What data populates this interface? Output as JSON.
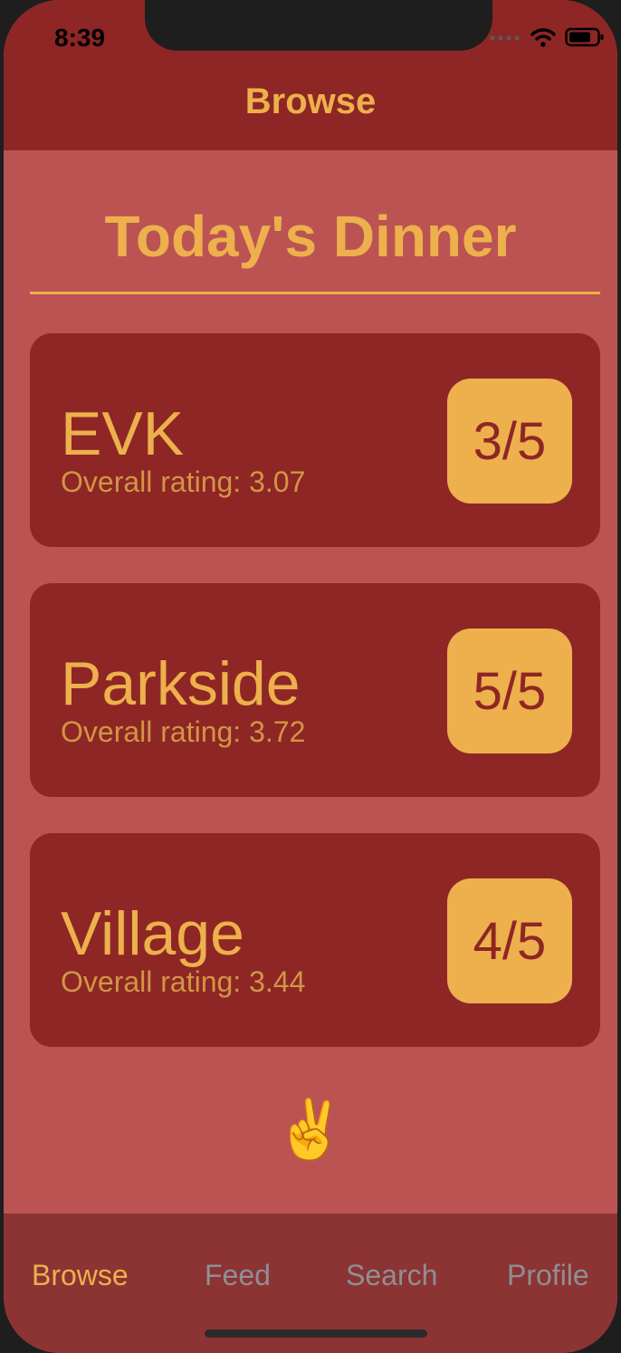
{
  "status_bar": {
    "time": "8:39"
  },
  "nav": {
    "title": "Browse"
  },
  "section": {
    "title": "Today's Dinner"
  },
  "cards": [
    {
      "name": "EVK",
      "rating_text": "Overall rating: 3.07",
      "score": "3/5"
    },
    {
      "name": "Parkside",
      "rating_text": "Overall rating: 3.72",
      "score": "5/5"
    },
    {
      "name": "Village",
      "rating_text": "Overall rating: 3.44",
      "score": "4/5"
    }
  ],
  "footer_emoji": "✌️",
  "tabs": [
    {
      "label": "Browse",
      "active": true
    },
    {
      "label": "Feed",
      "active": false
    },
    {
      "label": "Search",
      "active": false
    },
    {
      "label": "Profile",
      "active": false
    }
  ],
  "colors": {
    "nav_bg": "#8e2625",
    "content_bg": "#bb5353",
    "accent": "#edb04c",
    "tab_inactive": "#8f8f93"
  }
}
